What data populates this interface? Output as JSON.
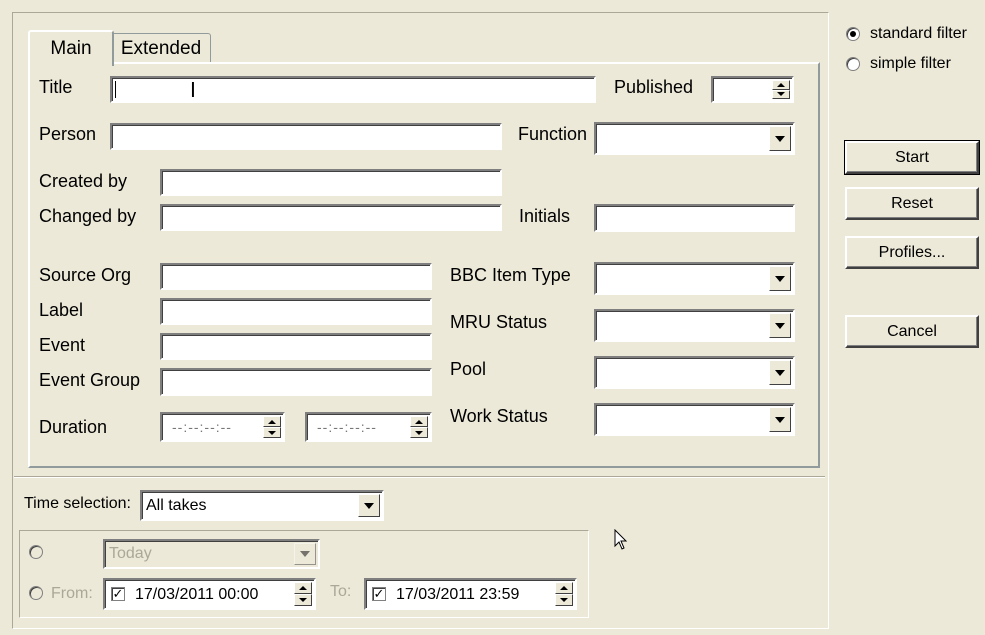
{
  "tabs": {
    "main": "Main",
    "extended": "Extended"
  },
  "fields": {
    "title": {
      "label": "Title",
      "value": ""
    },
    "published": {
      "label": "Published",
      "value": ""
    },
    "person": {
      "label": "Person",
      "value": ""
    },
    "function": {
      "label": "Function",
      "value": ""
    },
    "created_by": {
      "label": "Created by",
      "value": ""
    },
    "changed_by": {
      "label": "Changed by",
      "value": ""
    },
    "initials": {
      "label": "Initials",
      "value": ""
    },
    "source_org": {
      "label": "Source Org",
      "value": ""
    },
    "label": {
      "label": "Label",
      "value": ""
    },
    "event": {
      "label": "Event",
      "value": ""
    },
    "event_group": {
      "label": "Event Group",
      "value": ""
    },
    "duration": {
      "label": "Duration",
      "from": "--:--:--:--",
      "to": "--:--:--:--"
    },
    "bbc_item_type": {
      "label": "BBC Item Type",
      "value": ""
    },
    "mru_status": {
      "label": "MRU Status",
      "value": ""
    },
    "pool": {
      "label": "Pool",
      "value": ""
    },
    "work_status": {
      "label": "Work Status",
      "value": ""
    }
  },
  "filter_mode": {
    "standard": "standard filter",
    "simple": "simple filter",
    "selected": "standard"
  },
  "buttons": {
    "start": "Start",
    "reset": "Reset",
    "profiles": "Profiles...",
    "cancel": "Cancel"
  },
  "time_selection": {
    "label": "Time selection:",
    "value": "All takes",
    "relative_value": "Today",
    "from_label": "From:",
    "from_value": "17/03/2011 00:00",
    "to_label": "To:",
    "to_value": "17/03/2011 23:59"
  },
  "colors": {
    "background": "#ece9d8",
    "disabled_text": "#aca899"
  }
}
